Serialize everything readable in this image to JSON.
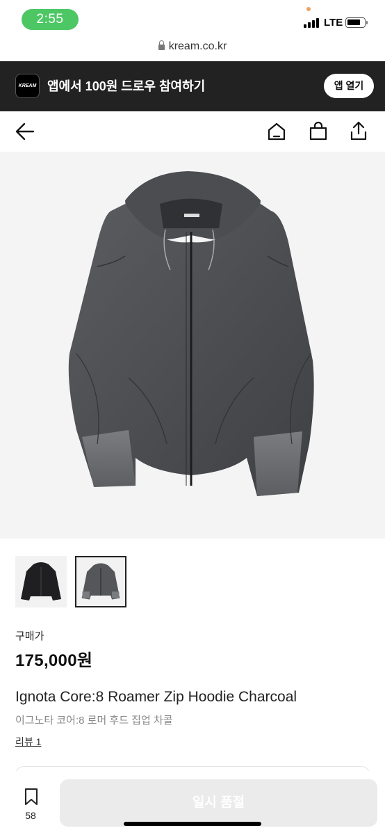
{
  "status_bar": {
    "time": "2:55",
    "network": "LTE"
  },
  "browser": {
    "url": "kream.co.kr"
  },
  "app_banner": {
    "logo_text": "KREAM",
    "text": "앱에서 100원 드로우 참여하기",
    "open_button": "앱 열기"
  },
  "nav": {
    "icons": [
      "back-arrow-icon",
      "home-icon",
      "shopping-bag-icon",
      "share-icon"
    ]
  },
  "gallery": {
    "images": [
      "black-hoodie",
      "charcoal-hoodie"
    ],
    "selected_index": 1
  },
  "product": {
    "price_label": "구매가",
    "price": "175,000원",
    "name_en": "Ignota Core:8 Roamer Zip Hoodie Charcoal",
    "name_ko": "이그노타 코어:8 로머 후드 집업 차콜",
    "review": "리뷰 1"
  },
  "bottom_bar": {
    "bookmark_count": "58",
    "action_label": "일시 품절"
  },
  "colors": {
    "banner_bg": "#222222",
    "status_pill": "#4cc764",
    "soldout_bg": "#ebebeb"
  }
}
